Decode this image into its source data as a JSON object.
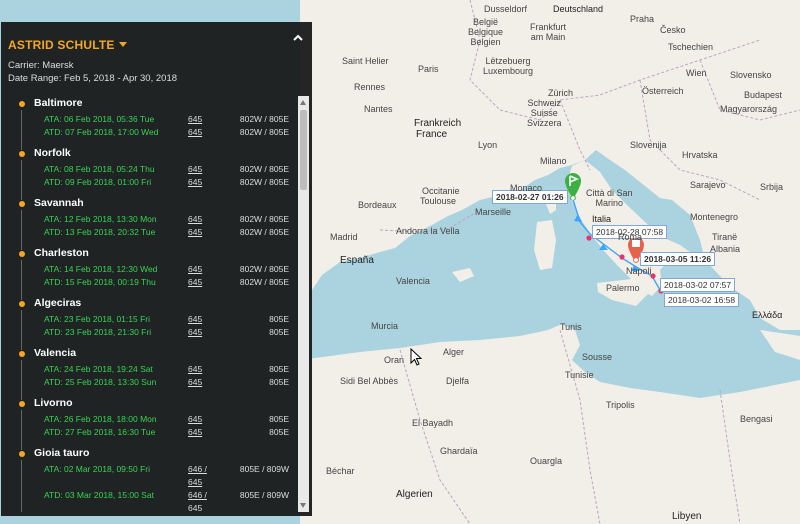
{
  "panel": {
    "customer": "ASTRID SCHULTE",
    "carrier": "Carrier: Maersk",
    "date_range": "Date Range: Feb 5, 2018 - Apr 30, 2018",
    "stops": [
      {
        "name": "Baltimore",
        "rows": [
          {
            "text": "ATA: 06 Feb 2018, 05:36 Tue",
            "voyage": "645",
            "dir": "802W / 805E"
          },
          {
            "text": "ATD: 07 Feb 2018, 17:00 Wed",
            "voyage": "645",
            "dir": "802W / 805E"
          }
        ]
      },
      {
        "name": "Norfolk",
        "rows": [
          {
            "text": "ATA: 08 Feb 2018, 05:24 Thu",
            "voyage": "645",
            "dir": "802W / 805E"
          },
          {
            "text": "ATD: 09 Feb 2018, 01:00 Fri",
            "voyage": "645",
            "dir": "802W / 805E"
          }
        ]
      },
      {
        "name": "Savannah",
        "rows": [
          {
            "text": "ATA: 12 Feb 2018, 13:30 Mon",
            "voyage": "645",
            "dir": "802W / 805E"
          },
          {
            "text": "ATD: 13 Feb 2018, 20:32 Tue",
            "voyage": "645",
            "dir": "802W / 805E"
          }
        ]
      },
      {
        "name": "Charleston",
        "rows": [
          {
            "text": "ATA: 14 Feb 2018, 12:30 Wed",
            "voyage": "645",
            "dir": "802W / 805E"
          },
          {
            "text": "ATD: 15 Feb 2018, 00:19 Thu",
            "voyage": "645",
            "dir": "802W / 805E"
          }
        ]
      },
      {
        "name": "Algeciras",
        "rows": [
          {
            "text": "ATA: 23 Feb 2018, 01:15 Fri",
            "voyage": "645",
            "dir": "805E"
          },
          {
            "text": "ATD: 23 Feb 2018, 21:30 Fri",
            "voyage": "645",
            "dir": "805E"
          }
        ]
      },
      {
        "name": "Valencia",
        "rows": [
          {
            "text": "ATA: 24 Feb 2018, 19:24 Sat",
            "voyage": "645",
            "dir": "805E"
          },
          {
            "text": "ATD: 25 Feb 2018, 13:30 Sun",
            "voyage": "645",
            "dir": "805E"
          }
        ]
      },
      {
        "name": "Livorno",
        "rows": [
          {
            "text": "ATA: 26 Feb 2018, 18:00 Mon",
            "voyage": "645",
            "dir": "805E"
          },
          {
            "text": "ATD: 27 Feb 2018, 16:30 Tue",
            "voyage": "645",
            "dir": "805E"
          }
        ]
      },
      {
        "name": "Gioia tauro",
        "rows": [
          {
            "text": "ATA: 02 Mar 2018, 09:50 Fri",
            "voyage": "646 /",
            "voyage2": "645",
            "dir": "805E / 809W"
          },
          {
            "text": "ATD: 03 Mar 2018, 15:00 Sat",
            "voyage": "646 /",
            "voyage2": "645",
            "dir": "805E / 809W"
          }
        ]
      }
    ]
  },
  "route_tags": {
    "t1": "2018-02-27 01:26",
    "t2": "2018-02-28 07:58",
    "t3": "2018-03-05 11:26",
    "t4": "2018-03-02 07:57",
    "t5": "2018-03-02 16:58"
  },
  "map_labels": {
    "dusseldorf": "Dusseldorf",
    "deutschland": "Deutschland",
    "belgique": "België\nBelgique\nBelgien",
    "frankfurt": "Frankfurt\nam Main",
    "luxembourg": "Lëtzebuerg\nLuxembourg",
    "cesko": "Česko",
    "praha": "Praha",
    "tschechien": "Tschechien",
    "slovensko": "Slovensko",
    "wien": "Wien",
    "osterreich": "Österreich",
    "budapest": "Budapest",
    "magyarorszag": "Magyarország",
    "saint_helier": "Saint Helier",
    "paris": "Paris",
    "rennes": "Rennes",
    "nantes": "Nantes",
    "france": "France",
    "frankreich": "Frankreich",
    "schweiz": "Schweiz\nSuisse\nSvizzera",
    "zurich": "Zürich",
    "lyon": "Lyon",
    "slovenija": "Slovenija",
    "hrvatska": "Hrvatska",
    "milano": "Milano",
    "monaco": "Monaco",
    "marseille": "Marseille",
    "san_marino": "Città di San\nMarino",
    "italia": "Italia",
    "sarajevo": "Sarajevo",
    "srbija": "Srbija",
    "montenegro": "Montenegro",
    "roma": "Roma",
    "napoli": "Napoli",
    "tirane": "Tiranë",
    "albania": "Albania",
    "palermo": "Palermo",
    "greece": "Ελλάδα",
    "bordeaux": "Bordeaux",
    "toulouse": "Toulouse",
    "occitanie": "Occitanie",
    "andorra": "Andorra la Vella",
    "madrid": "Madrid",
    "espana": "España",
    "valencia": "Valencia",
    "murcia": "Murcia",
    "oran": "Oran",
    "alger": "Alger",
    "tunis": "Tunis",
    "tunisie": "Tunisie",
    "sidi": "Sidi Bel Abbès",
    "djelfa": "Djelfa",
    "sousse": "Sousse",
    "tripolis": "Tripolis",
    "bengasi": "Bengasi",
    "algerien": "Algerien",
    "libyen": "Libyen",
    "elbayadh": "El Bayadh",
    "ghardaia": "Ghardaïa",
    "bechar": "Béchar",
    "ouargla": "Ouargla"
  }
}
